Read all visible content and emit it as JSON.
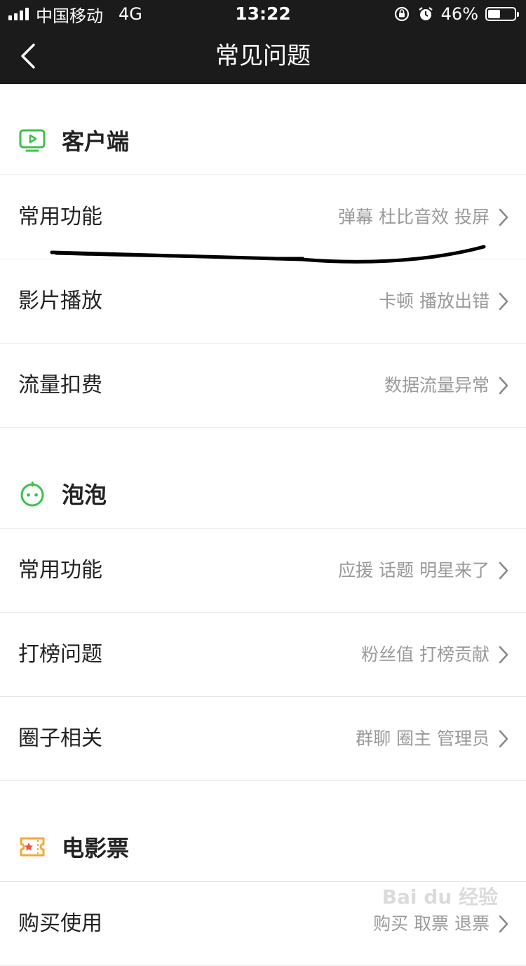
{
  "status": {
    "carrier": "中国移动",
    "network": "4G",
    "time": "13:22",
    "battery": "46%",
    "battery_level": 0.46
  },
  "nav": {
    "title": "常见问题",
    "back_icon": "chevron-left-icon"
  },
  "colors": {
    "bar_bg": "#1b1b1b",
    "accent_green": "#3cc24a",
    "ticket_orange": "#f2a93b"
  },
  "sections": [
    {
      "title": "客户端",
      "icon": "tv-play-icon",
      "rows": [
        {
          "label": "常用功能",
          "tags": "弹幕 杜比音效 投屏"
        },
        {
          "label": "影片播放",
          "tags": "卡顿 播放出错"
        },
        {
          "label": "流量扣费",
          "tags": "数据流量异常"
        }
      ]
    },
    {
      "title": "泡泡",
      "icon": "bubble-face-icon",
      "rows": [
        {
          "label": "常用功能",
          "tags": "应援 话题 明星来了"
        },
        {
          "label": "打榜问题",
          "tags": "粉丝值 打榜贡献"
        },
        {
          "label": "圈子相关",
          "tags": "群聊 圈主 管理员"
        }
      ]
    },
    {
      "title": "电影票",
      "icon": "movie-ticket-icon",
      "rows": [
        {
          "label": "购买使用",
          "tags": "购买 取票 退票"
        }
      ]
    }
  ],
  "watermark": "Bai du 经验"
}
